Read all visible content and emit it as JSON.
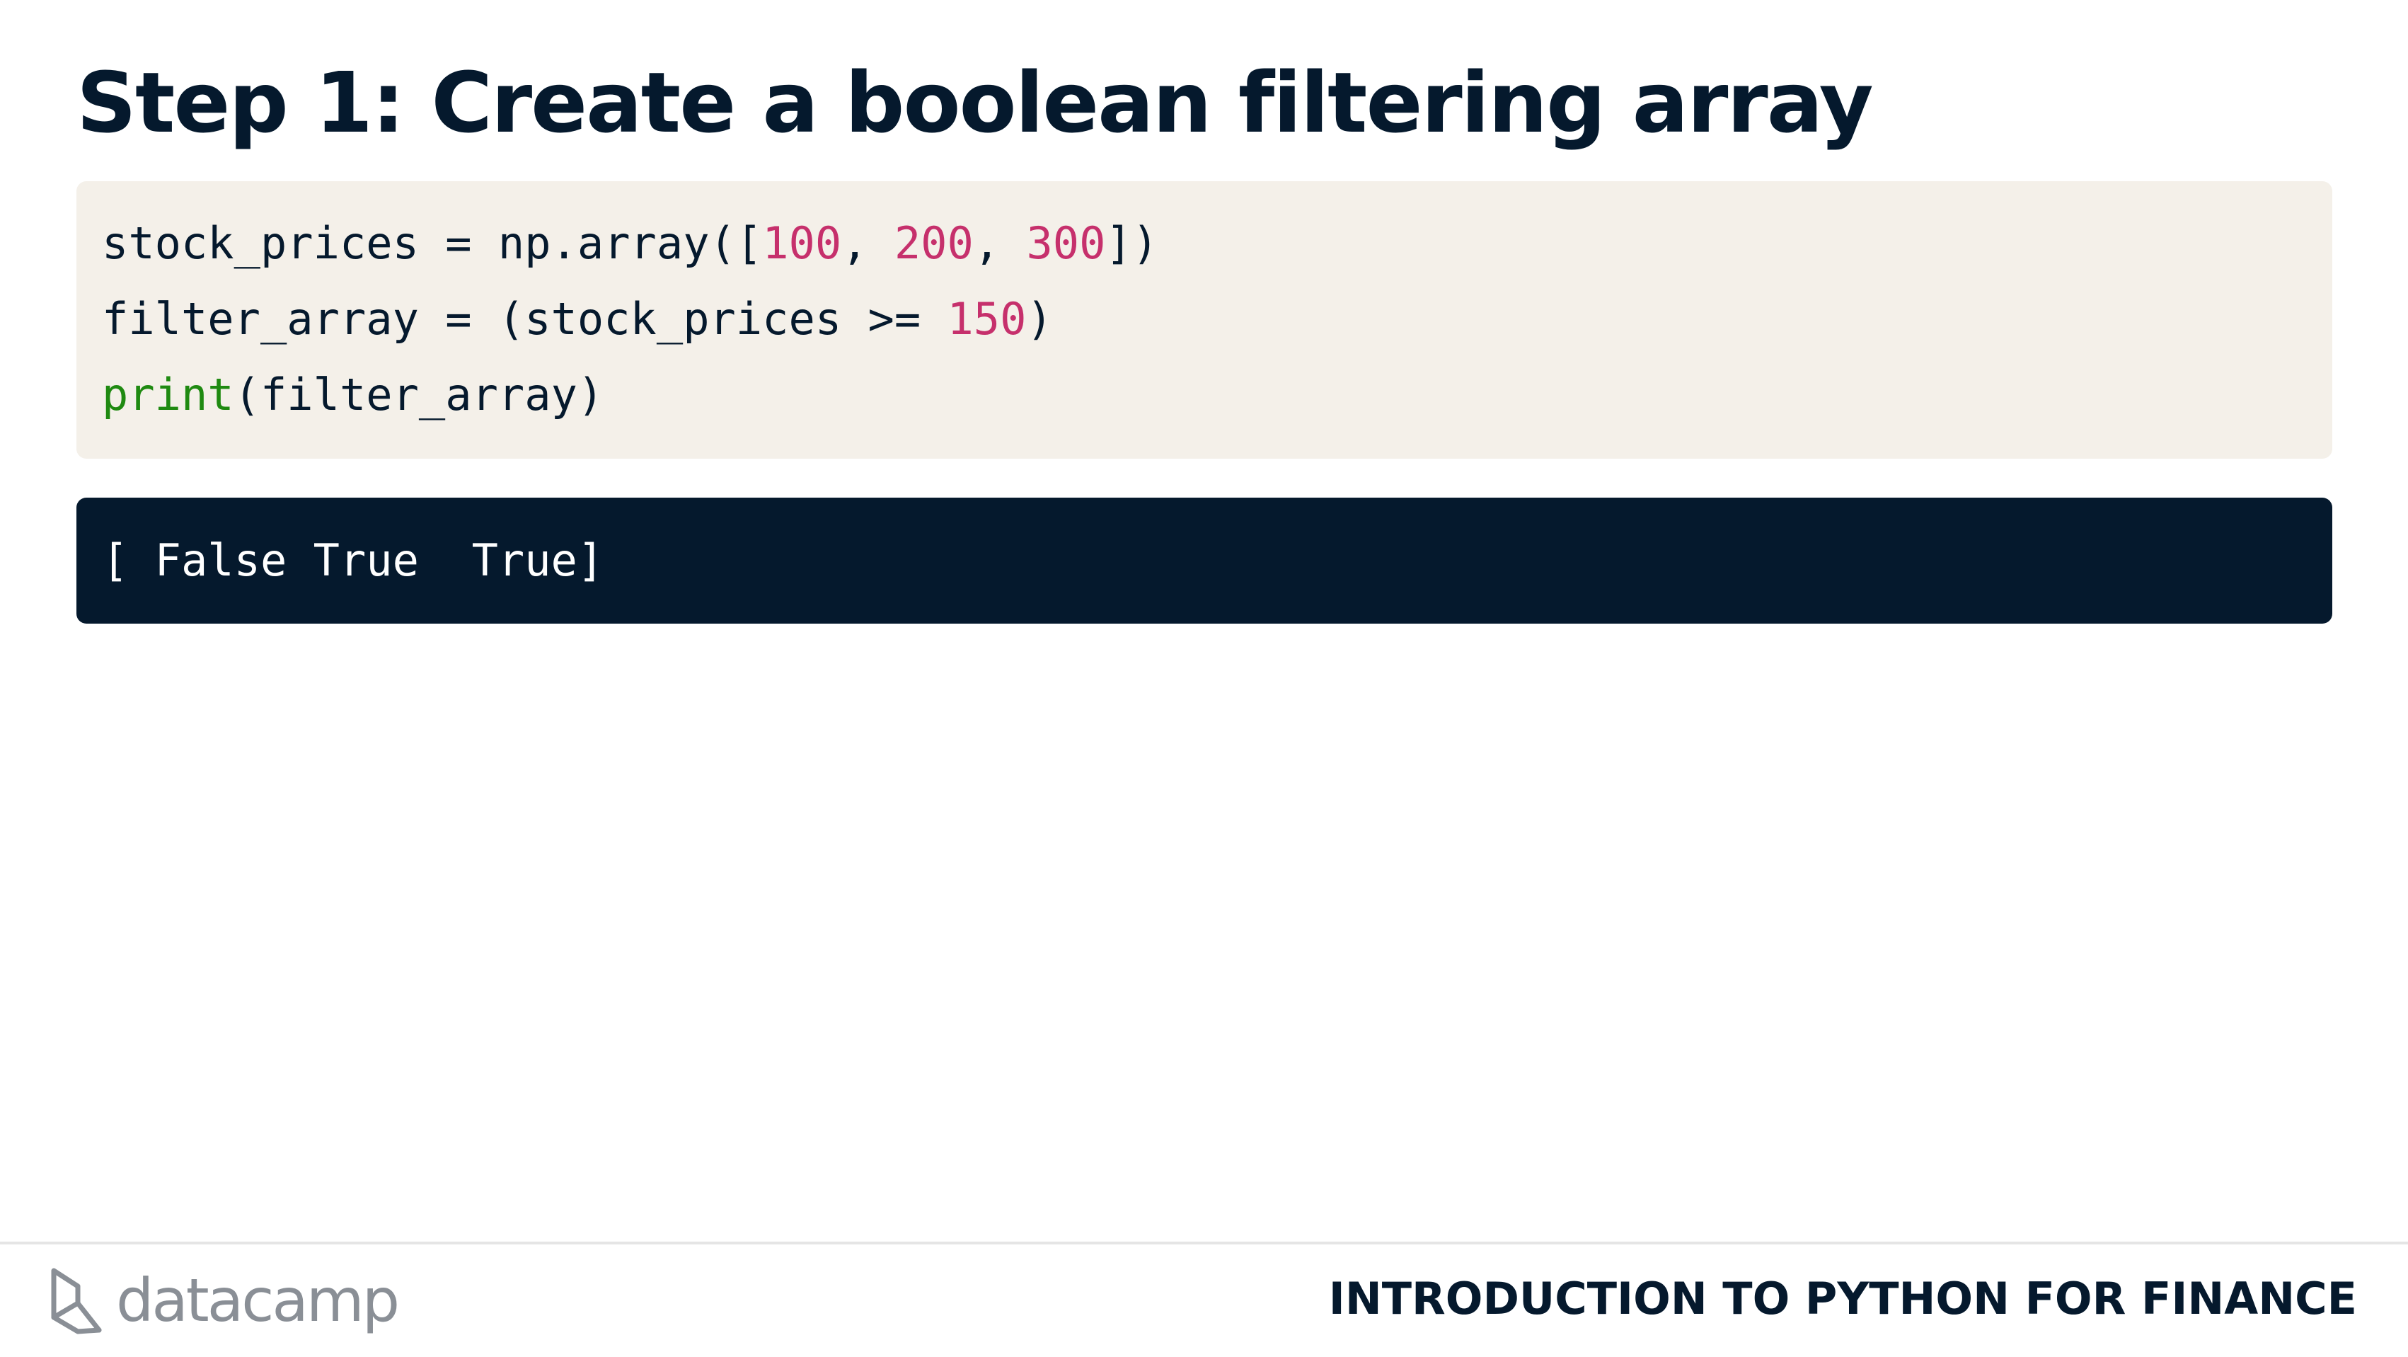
{
  "slide": {
    "title": "Step 1: Create a boolean filtering array"
  },
  "code": {
    "line1": {
      "part1": "stock_prices = np.array([",
      "num1": "100",
      "sep1": ", ",
      "num2": "200",
      "sep2": ", ",
      "num3": "300",
      "part2": "])"
    },
    "line2": {
      "part1": "filter_array = (stock_prices >= ",
      "num1": "150",
      "part2": ")"
    },
    "line3": {
      "builtin": "print",
      "part1": "(filter_array)"
    }
  },
  "output": {
    "text": "[ False True  True]"
  },
  "footer": {
    "logo_text": "datacamp",
    "logo_icon": "datacamp-logo-icon",
    "course_name": "INTRODUCTION TO PYTHON FOR FINANCE"
  },
  "colors": {
    "title": "#05192d",
    "code_background": "#f4f0e9",
    "output_background": "#05192d",
    "number_token": "#c6306c",
    "builtin_token": "#1f8a11",
    "logo": "#8a8f96"
  }
}
